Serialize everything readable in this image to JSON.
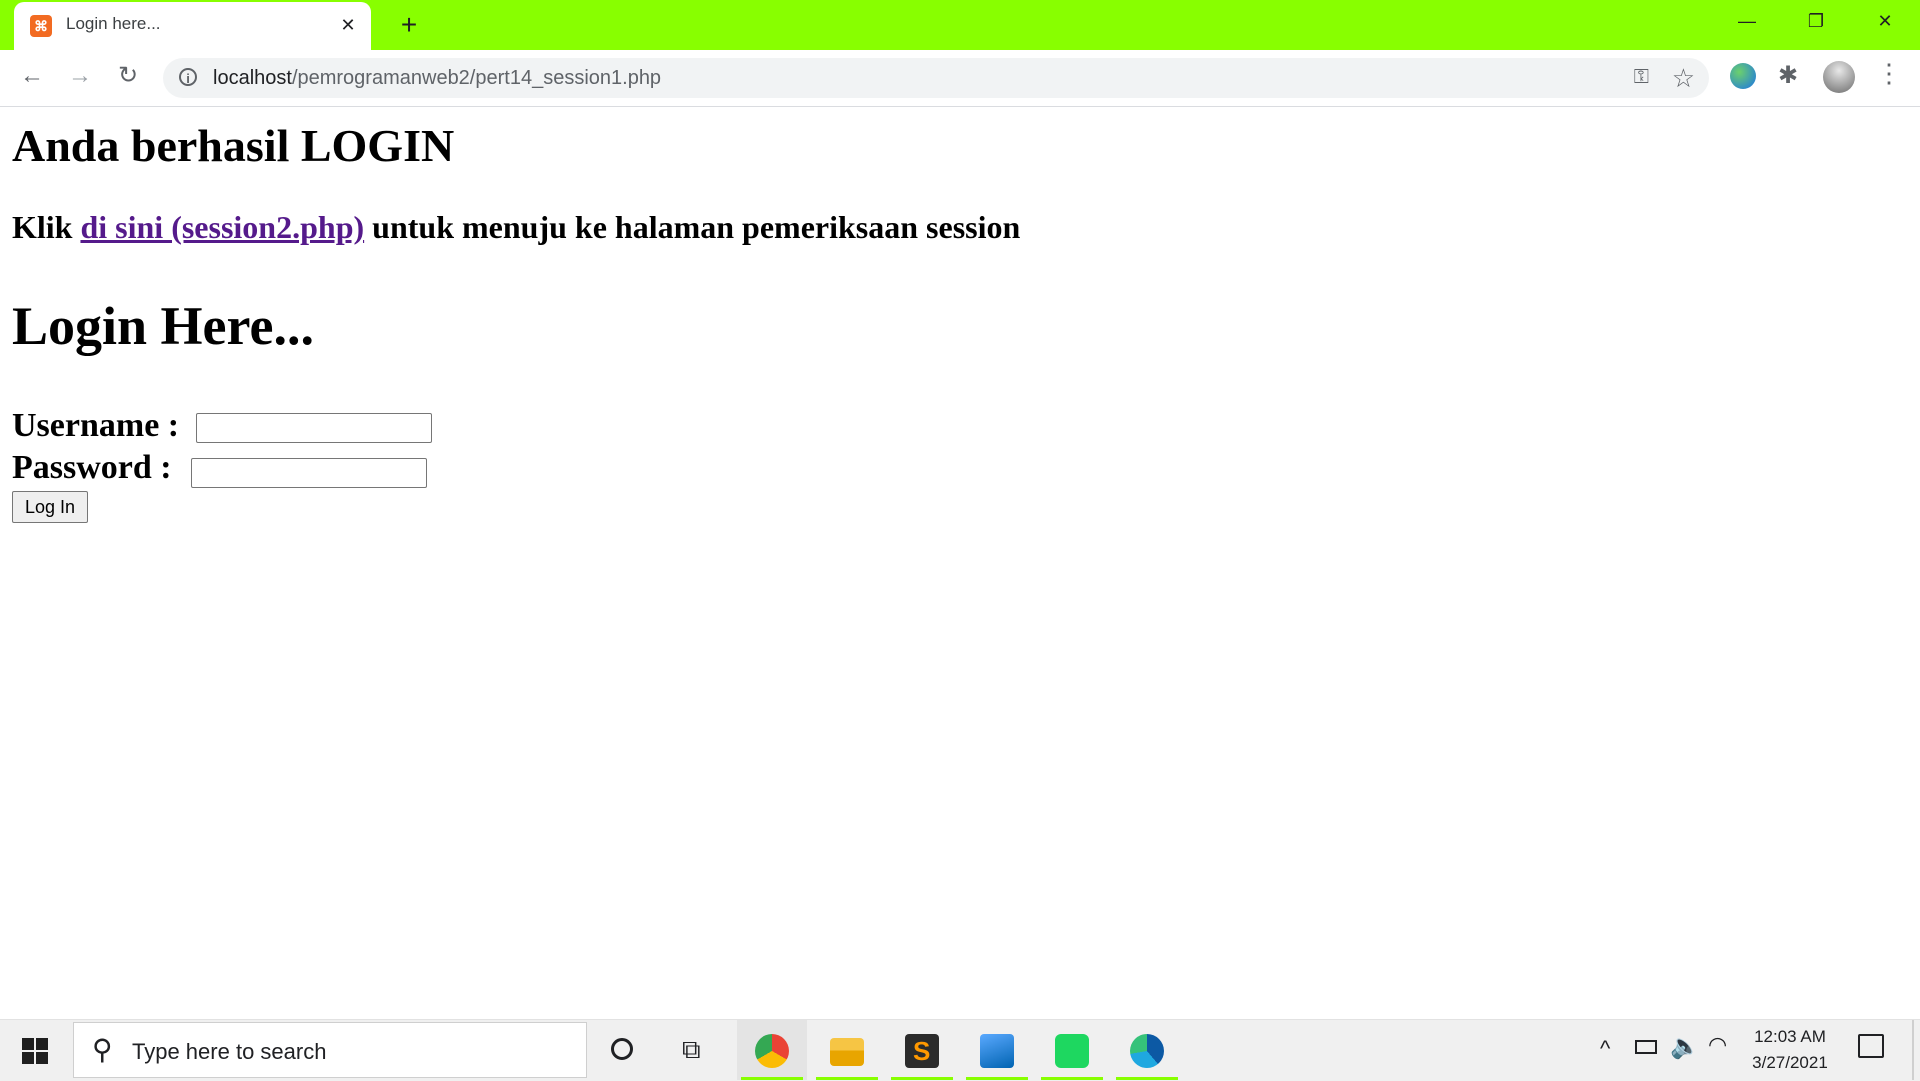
{
  "browser": {
    "tab": {
      "title": "Login here...",
      "favicon": "xampp-icon",
      "close_glyph": "✕"
    },
    "new_tab_glyph": "+",
    "window_controls": {
      "minimize": "—",
      "restore": "❐",
      "close": "✕"
    },
    "toolbar": {
      "back_glyph": "←",
      "forward_glyph": "→",
      "reload_glyph": "↻",
      "url_host": "localhost",
      "url_path": "/pemrogramanweb2/pert14_session1.php",
      "key_glyph": "⚿",
      "star_glyph": "☆",
      "puzzle_glyph": "✱",
      "menu_glyph": "⋮"
    }
  },
  "page": {
    "success_heading": "Anda berhasil LOGIN",
    "session_prefix": "Klik ",
    "session_link": "di sini (session2.php)",
    "session_suffix": " untuk menuju ke halaman pemeriksaan session",
    "login_heading": "Login Here...",
    "username_label": "Username :",
    "password_label": "Password :",
    "username_value": "",
    "password_value": "",
    "login_button": "Log In",
    "link_color": "#551a8b"
  },
  "taskbar": {
    "search_placeholder": "Type here to search",
    "search_glyph": "⚲",
    "taskview_glyph": "⧉",
    "apps": [
      "chrome-icon",
      "file-explorer-icon",
      "sublime-text-icon",
      "photos-icon",
      "spotify-icon",
      "edge-icon"
    ],
    "tray": {
      "chevron_glyph": "^",
      "volume_glyph": "🔈",
      "wifi_glyph": "◠"
    },
    "clock_time": "12:03 AM",
    "clock_date": "3/27/2021",
    "accent_color": "#88ff00"
  }
}
